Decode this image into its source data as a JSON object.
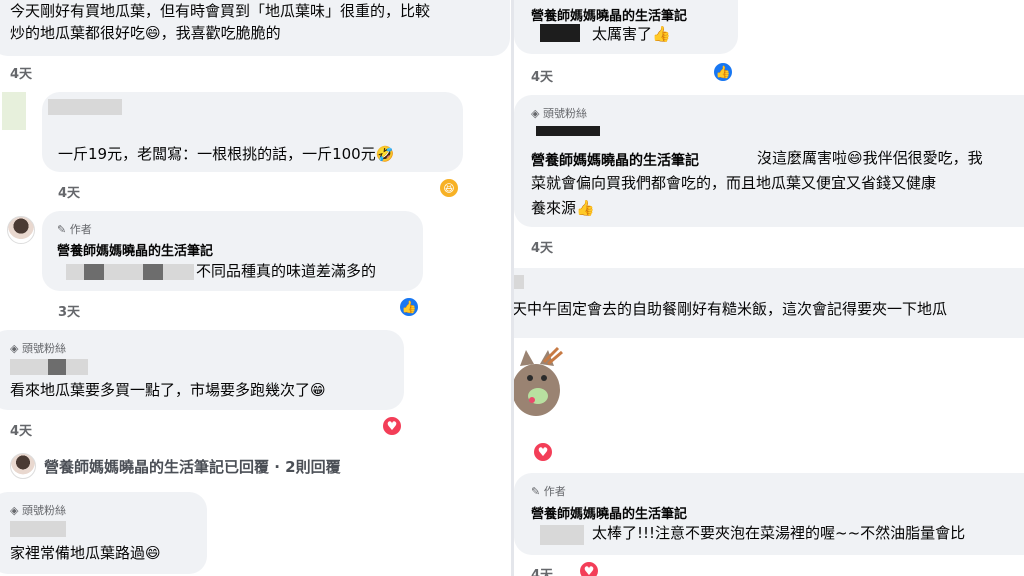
{
  "left": {
    "c1": {
      "line1": "今天剛好有買地瓜葉，但有時會買到「地瓜葉味」很重的，比較",
      "line2": "炒的地瓜葉都很好吃😄，我喜歡吃脆脆的",
      "time": "4天"
    },
    "c2": {
      "text": "一斤19元，老闆寫：一根根挑的話，一斤100元🤣",
      "time": "4天"
    },
    "c3": {
      "badge": "作者",
      "name": "營養師媽媽曉晶的生活筆記",
      "text": "不同品種真的味道差滿多的",
      "time": "3天"
    },
    "c4": {
      "badge": "頭號粉絲",
      "text": "看來地瓜葉要多買一點了，市場要多跑幾次了😁",
      "time": "4天"
    },
    "replies": "營養師媽媽曉晶的生活筆記已回覆 · 2則回覆",
    "c5": {
      "badge": "頭號粉絲",
      "text": "家裡常備地瓜葉路過😄"
    }
  },
  "right": {
    "c1": {
      "name": "營養師媽媽曉晶的生活筆記",
      "text": "太厲害了👍",
      "time": "4天"
    },
    "c2": {
      "badge": "頭號粉絲",
      "name": "營養師媽媽曉晶的生活筆記",
      "line1": "沒這麼厲害啦😄我伴侶很愛吃，我",
      "line2": "菜就會偏向買我們都會吃的，而且地瓜葉又便宜又省錢又健康",
      "line3": "養來源👍",
      "time": "4天"
    },
    "c3": {
      "text": "天中午固定會去的自助餐剛好有糙米飯，這次會記得要夾一下地瓜"
    },
    "c4": {
      "badge": "作者",
      "name": "營養師媽媽曉晶的生活筆記",
      "text": "太棒了!!!注意不要夾泡在菜湯裡的喔~~不然油脂量會比",
      "time": "4天"
    }
  },
  "icons": {
    "like": "like-reaction-icon",
    "love": "love-reaction-icon",
    "haha": "haha-reaction-icon",
    "pen": "pen-icon",
    "diamond": "diamond-icon"
  },
  "colors": {
    "bubble": "#f0f2f5",
    "like": "#1877f2",
    "love": "#f33e58",
    "meta": "#65676b"
  }
}
